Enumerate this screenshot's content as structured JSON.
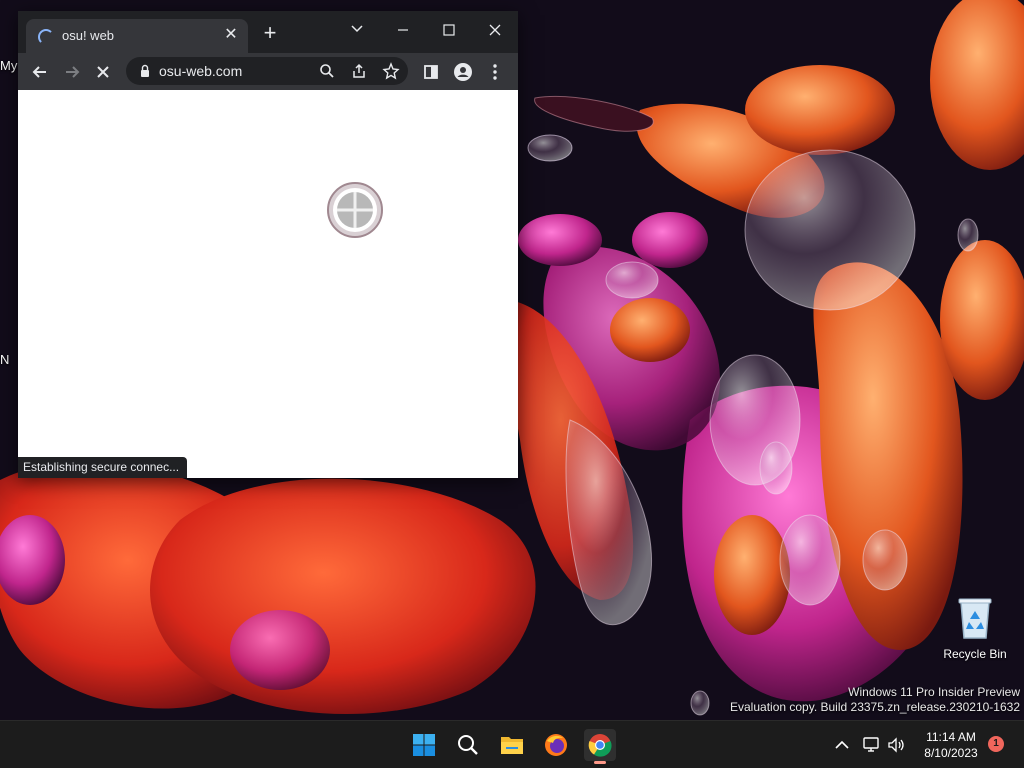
{
  "desktop": {
    "edge_labels": [
      "My",
      "N"
    ],
    "recycle_bin": {
      "label": "Recycle Bin",
      "icon": "recycle-bin-icon"
    },
    "watermark": {
      "line1": "Windows 11 Pro Insider Preview",
      "line2": "Evaluation copy. Build 23375.zn_release.230210-1632"
    }
  },
  "browser": {
    "tab": {
      "title": "osu! web",
      "close_icon": "close-icon",
      "loading": true
    },
    "window_controls": [
      "chevron-down-icon",
      "minimize-icon",
      "maximize-icon",
      "close-icon"
    ],
    "toolbar": {
      "back_icon": "back-arrow-icon",
      "forward_icon": "forward-arrow-icon",
      "stop_icon": "stop-loading-icon",
      "url": "osu-web.com",
      "omnibox_icons": [
        "lock-icon",
        "zoom-search-icon",
        "share-icon",
        "bookmark-star-icon"
      ],
      "right_icons": [
        "side-panel-icon",
        "profile-icon",
        "menu-icon"
      ]
    },
    "page": {
      "status_text": "Establishing secure connec..."
    }
  },
  "taskbar": {
    "apps": [
      "windows-start-icon",
      "search-icon",
      "file-explorer-icon",
      "firefox-icon",
      "chrome-icon"
    ],
    "active_app": "chrome-icon",
    "tray": [
      "show-hidden-icons-chevron",
      "network-icon",
      "volume-icon"
    ],
    "time": "11:14 AM",
    "date": "8/10/2023",
    "notification_count": "1"
  }
}
